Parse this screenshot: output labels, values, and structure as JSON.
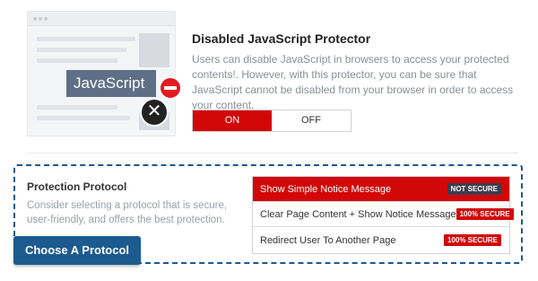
{
  "illustration": {
    "text": "JavaScript",
    "icons": [
      "no-entry-icon",
      "close-icon"
    ],
    "colors": {
      "label_bg": "#5f6f86",
      "no_entry": "#e31b23",
      "close": "#222222"
    }
  },
  "js_protector": {
    "title": "Disabled JavaScript Protector",
    "description": "Users can disable JavaScript in browsers to access your protected contents!. However, with this protector, you can be sure that JavaScript cannot be disabled from your browser in order to access your content.",
    "toggle": {
      "on_label": "ON",
      "off_label": "OFF",
      "selected": "ON"
    }
  },
  "protection_protocol": {
    "title": "Protection Protocol",
    "description": "Consider selecting a protocol that is secure, user-friendly, and offers the best protection.",
    "choose_button": "Choose A Protocol",
    "options": [
      {
        "label": "Show Simple Notice Message",
        "badge": "NOT SECURE",
        "selected": true
      },
      {
        "label": "Clear Page Content + Show Notice Message",
        "badge": "100% SECURE",
        "selected": false
      },
      {
        "label": "Redirect User To Another Page",
        "badge": "100% SECURE",
        "selected": false
      }
    ]
  },
  "colors": {
    "accent_red": "#d20808",
    "primary_blue": "#1c5a8f",
    "badge_dark": "#3d3d4e"
  }
}
